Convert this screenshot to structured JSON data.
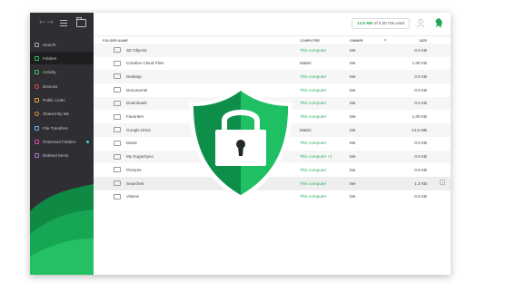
{
  "sidebar": {
    "items": [
      {
        "label": "Search",
        "icon": "search-icon"
      },
      {
        "label": "Folders",
        "icon": "folder-icon"
      },
      {
        "label": "Activity",
        "icon": "activity-icon"
      },
      {
        "label": "Devices",
        "icon": "devices-icon"
      },
      {
        "label": "Public Links",
        "icon": "link-icon"
      },
      {
        "label": "Shared By Me",
        "icon": "share-icon"
      },
      {
        "label": "File Transfers",
        "icon": "transfer-icon"
      },
      {
        "label": "Protected Folders",
        "icon": "lock-icon"
      },
      {
        "label": "Deleted Items",
        "icon": "trash-icon"
      }
    ]
  },
  "header": {
    "storage_used": "14.5 MB",
    "storage_rest": "of 5.00 GB used"
  },
  "table": {
    "columns": {
      "name": "FOLDER NAME",
      "computer": "COMPUTER",
      "owner": "OWNER",
      "size": "SIZE"
    },
    "rows": [
      {
        "name": "3D Objects",
        "computer": "This computer",
        "owner": "Me",
        "size": "0.0 KB"
      },
      {
        "name": "Creative Cloud Files",
        "computer": "Mabni",
        "owner": "Me",
        "size": "1.00 KB"
      },
      {
        "name": "Desktop",
        "computer": "This computer",
        "owner": "Me",
        "size": "0.0 KB"
      },
      {
        "name": "Documents",
        "computer": "This computer",
        "owner": "Me",
        "size": "0.0 KB"
      },
      {
        "name": "Downloads",
        "computer": "This computer",
        "owner": "Me",
        "size": "0.0 KB"
      },
      {
        "name": "Favorites",
        "computer": "This computer",
        "owner": "Me",
        "size": "1.00 KB"
      },
      {
        "name": "Google Drive",
        "computer": "Mabni",
        "owner": "Me",
        "size": "14.5 MB"
      },
      {
        "name": "Music",
        "computer": "This computer",
        "owner": "Me",
        "size": "0.0 KB"
      },
      {
        "name": "My SugarSync",
        "computer": "This computer +1",
        "owner": "Me",
        "size": "0.0 KB"
      },
      {
        "name": "Pictures",
        "computer": "This computer",
        "owner": "Me",
        "size": "0.0 KB"
      },
      {
        "name": "Searches",
        "computer": "This computer",
        "owner": "Me",
        "size": "1.3 KB"
      },
      {
        "name": "Videos",
        "computer": "This computer",
        "owner": "Me",
        "size": "0.0 KB"
      }
    ]
  },
  "colors": {
    "accent": "#2faf5a",
    "sidebar": "#2f2f33",
    "shield_dark": "#0d8f4a",
    "shield_light": "#1fbf63"
  }
}
